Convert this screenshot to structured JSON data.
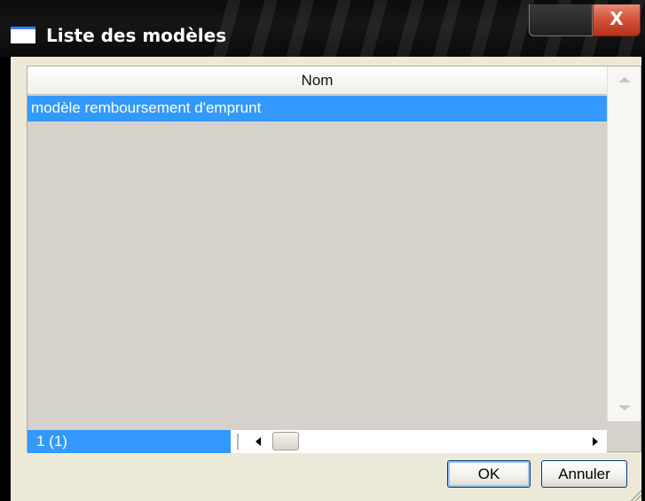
{
  "window": {
    "title": "Liste des modèles",
    "close_glyph": "X"
  },
  "grid": {
    "column_header": "Nom",
    "rows": [
      {
        "label": "modèle remboursement d'emprunt",
        "selected": true
      }
    ],
    "record_counter": "1 (1)"
  },
  "buttons": {
    "ok": "OK",
    "cancel": "Annuler"
  },
  "colors": {
    "selection": "#3399ff",
    "grid_background": "#d6d2cb",
    "dialog_background": "#ece9d8",
    "title_bar": "#0c0c0c",
    "close_button": "#d4553b"
  }
}
